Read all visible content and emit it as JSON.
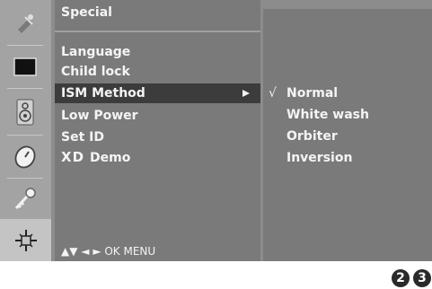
{
  "sidebar": {
    "icons": [
      "satellite-icon",
      "picture-icon",
      "speaker-icon",
      "clock-icon",
      "key-icon",
      "special-icon"
    ],
    "selected_index": 5
  },
  "menu": {
    "title": "Special",
    "items": [
      {
        "label": "Language"
      },
      {
        "label": "Child lock"
      },
      {
        "label": "ISM Method"
      },
      {
        "label": "Low Power"
      },
      {
        "label": "Set ID"
      },
      {
        "label": "Demo",
        "prefix": "XD"
      }
    ],
    "selected": "ISM Method",
    "nav_hint": "▲▼ ◄ ► OK MENU"
  },
  "submenu": {
    "items": [
      {
        "label": "Normal",
        "checked": true
      },
      {
        "label": "White wash",
        "checked": false
      },
      {
        "label": "Orbiter",
        "checked": false
      },
      {
        "label": "Inversion",
        "checked": false
      }
    ],
    "check_mark": "√"
  },
  "page_numbers": [
    "2",
    "3"
  ]
}
